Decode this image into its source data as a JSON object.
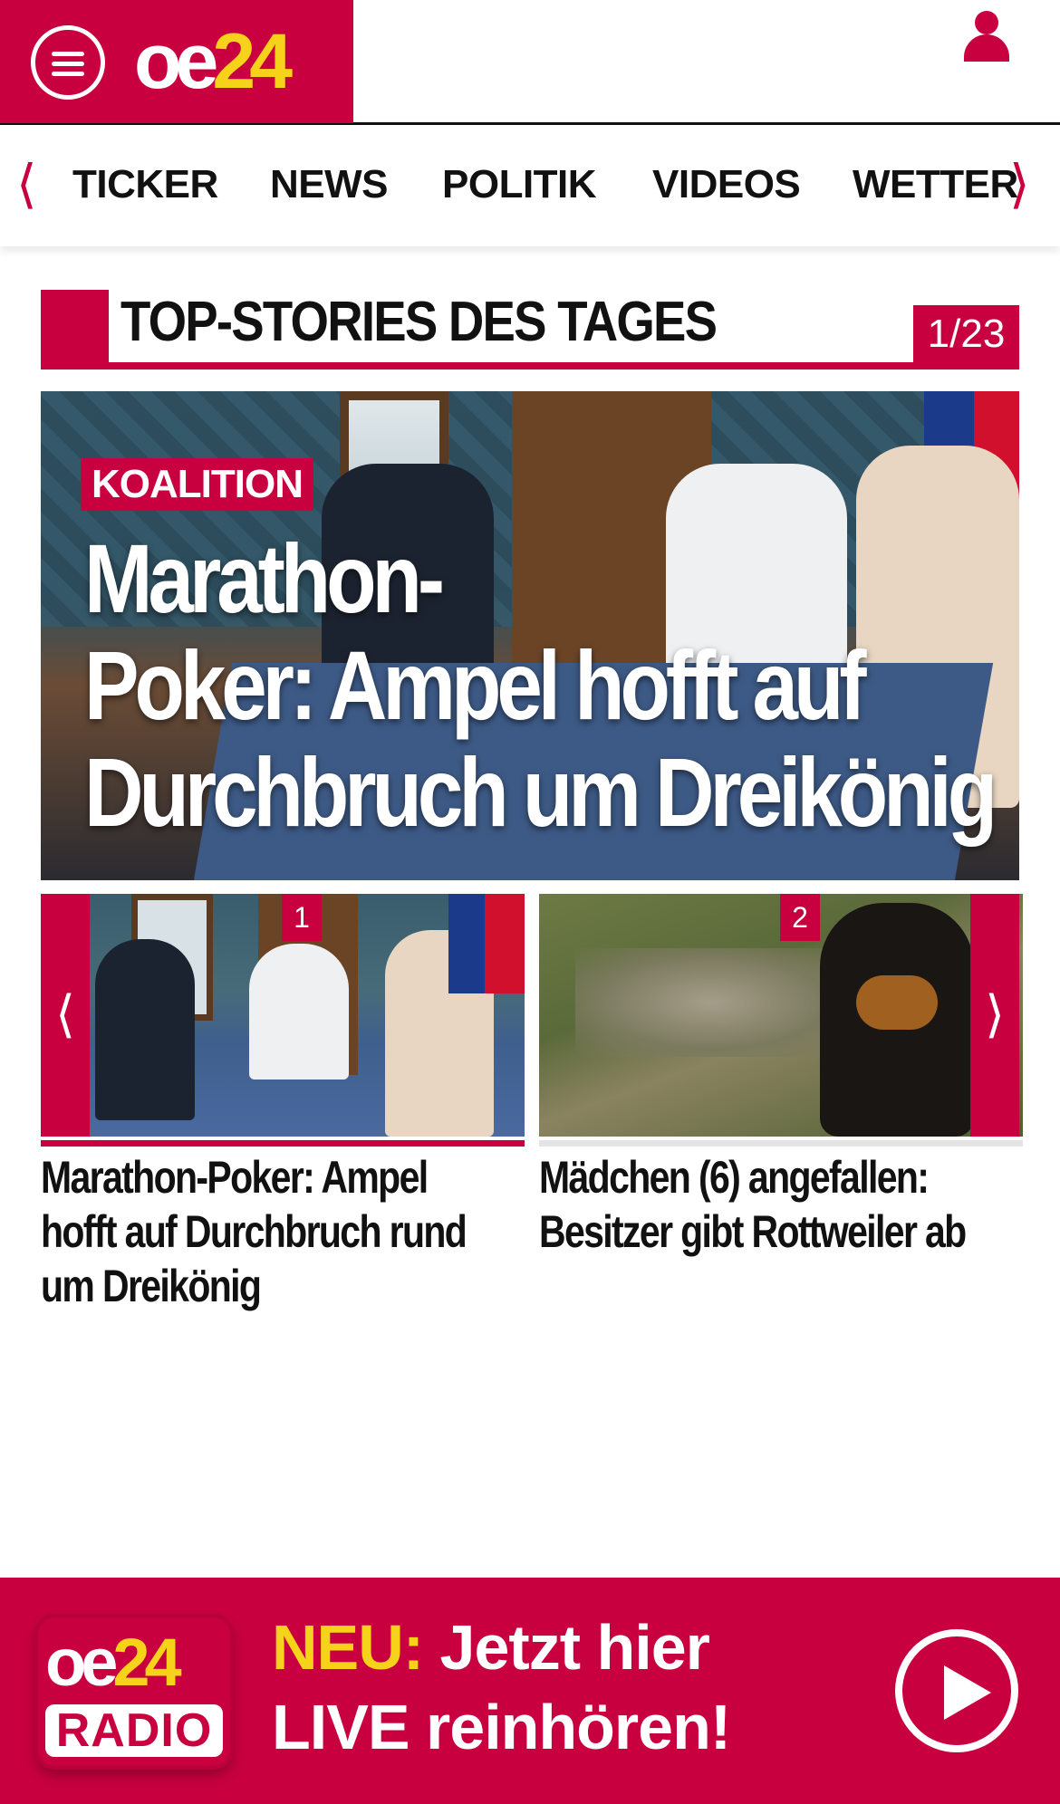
{
  "header": {
    "logo_oe": "oe",
    "logo_num": "24"
  },
  "nav": {
    "items": [
      "TICKER",
      "NEWS",
      "POLITIK",
      "VIDEOS",
      "WETTER"
    ],
    "prev_arrow": "⟨",
    "next_arrow": "⟩"
  },
  "section": {
    "title": "TOP-STORIES DES TAGES",
    "counter": "1/23"
  },
  "hero": {
    "badge": "KOALITION",
    "headline_lines": [
      "Marathon-",
      "Poker: Ampel hofft auf",
      "Durchbruch um Dreikönig"
    ]
  },
  "carousel": {
    "prev_arrow": "⟨",
    "next_arrow": "⟩",
    "cards": [
      {
        "num": "1",
        "caption_lines": [
          "Marathon-Poker: Ampel",
          "hofft auf Durchbruch rund",
          "um Dreikönig"
        ]
      },
      {
        "num": "2",
        "caption_lines": [
          "Mädchen (6) angefallen:",
          "Besitzer gibt Rottweiler ab"
        ]
      }
    ]
  },
  "banner": {
    "logo_oe": "oe",
    "logo_num": "24",
    "logo_sub": "RADIO",
    "neu": "NEU:",
    "line1_rest": " Jetzt hier",
    "line2": "LIVE reinhören!"
  },
  "colors": {
    "brand_red": "#c8003f",
    "brand_yellow": "#f7d21a"
  },
  "icons": [
    "menu-icon",
    "user-icon",
    "chevron-left-icon",
    "chevron-right-icon",
    "play-icon"
  ]
}
